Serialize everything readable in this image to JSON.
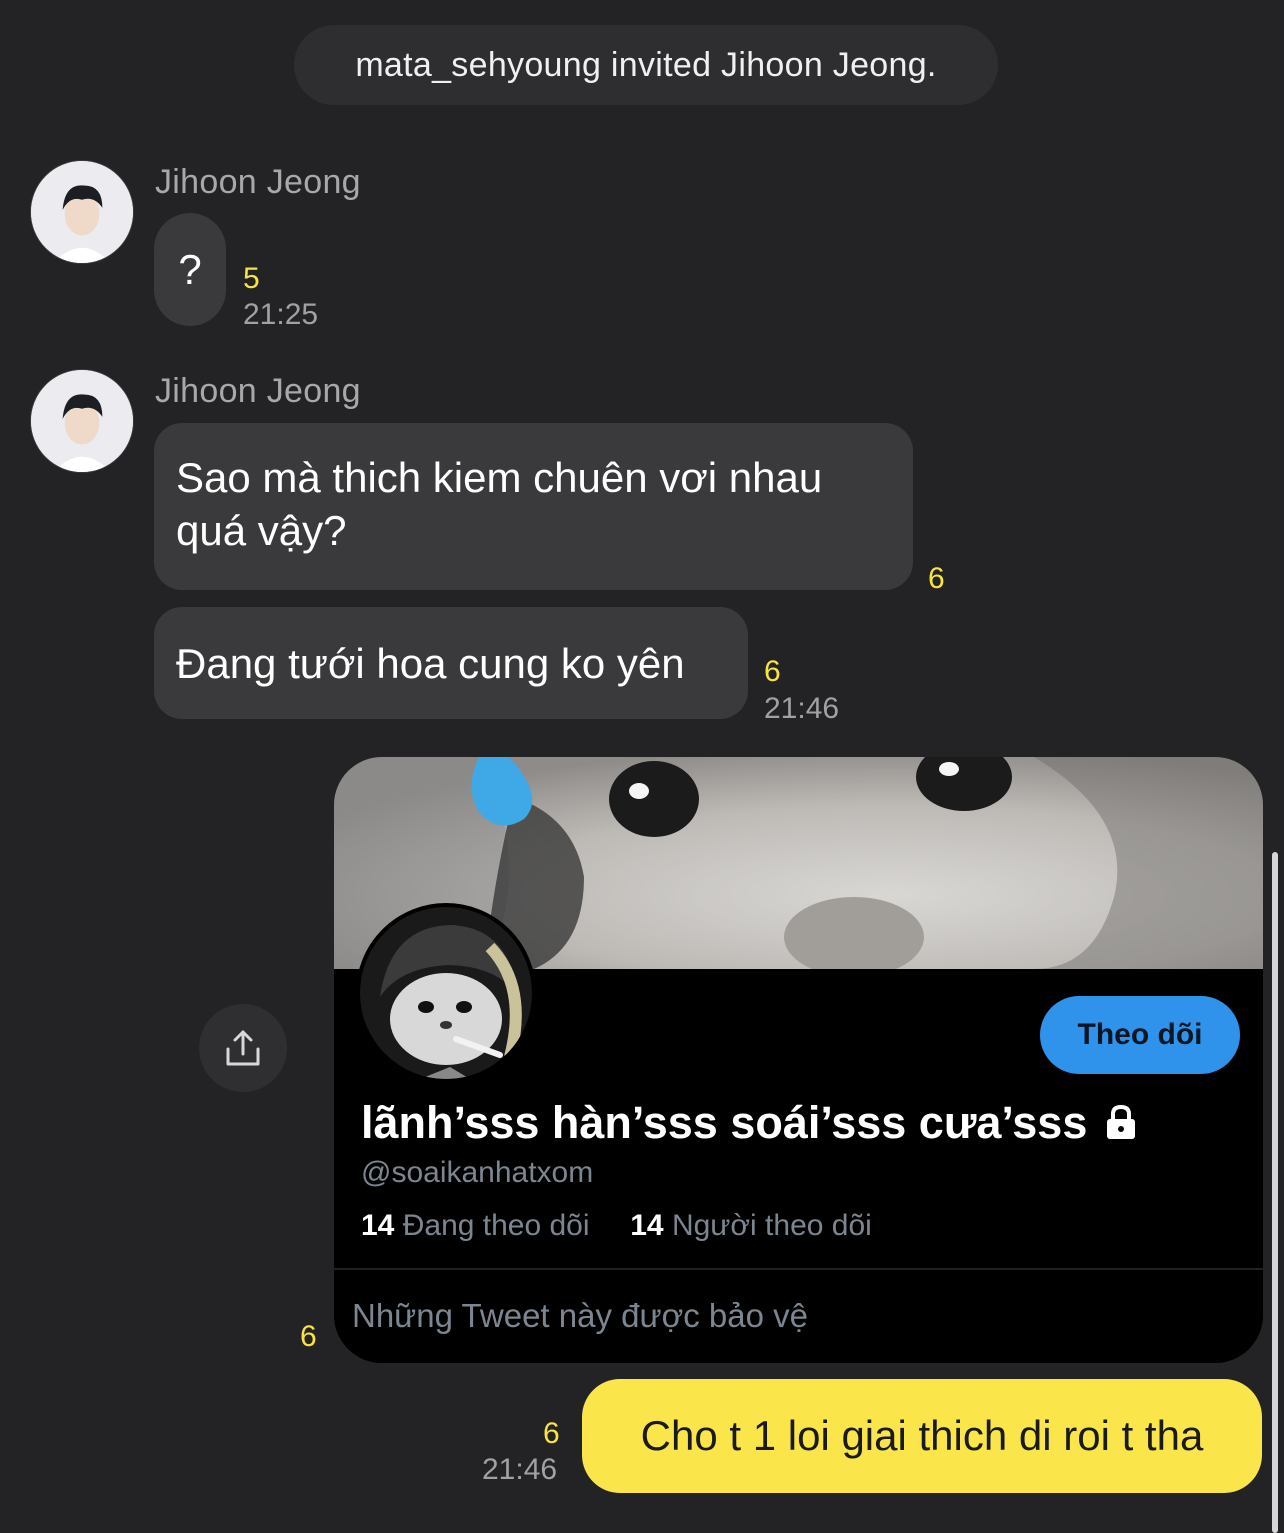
{
  "system_notice": "mata_sehyoung invited Jihoon Jeong.",
  "messages": [
    {
      "sender": "Jihoon Jeong",
      "text": "?",
      "unread": "5",
      "time": "21:25"
    },
    {
      "sender": "Jihoon Jeong",
      "text": "Sao mà thich kiem chuên vơi nhau quá vậy?",
      "unread": "6"
    },
    {
      "text": "Đang tưới hoa cung ko yên",
      "unread": "6",
      "time": "21:46"
    }
  ],
  "shared_card": {
    "follow_label": "Theo dõi",
    "display_name": "lãnh’sss hàn’sss soái’sss cưa’sss",
    "lock_icon": "lock-icon",
    "handle": "@soaikanhatxom",
    "following_count": "14",
    "following_label": "Đang theo dõi",
    "followers_count": "14",
    "followers_label": "Người theo dõi",
    "protected_text": "Những Tweet này được bảo vệ",
    "unread": "6",
    "share_icon": "share-icon",
    "colors": {
      "follow_button": "#2f93ec",
      "card_background": "#000000"
    }
  },
  "my_message": {
    "text": "Cho t 1 loi giai thich di roi t tha",
    "unread": "6",
    "time": "21:46"
  },
  "colors": {
    "background": "#232325",
    "bubble_other": "#3a3a3c",
    "bubble_mine": "#fae64b",
    "unread": "#f7e43c"
  }
}
